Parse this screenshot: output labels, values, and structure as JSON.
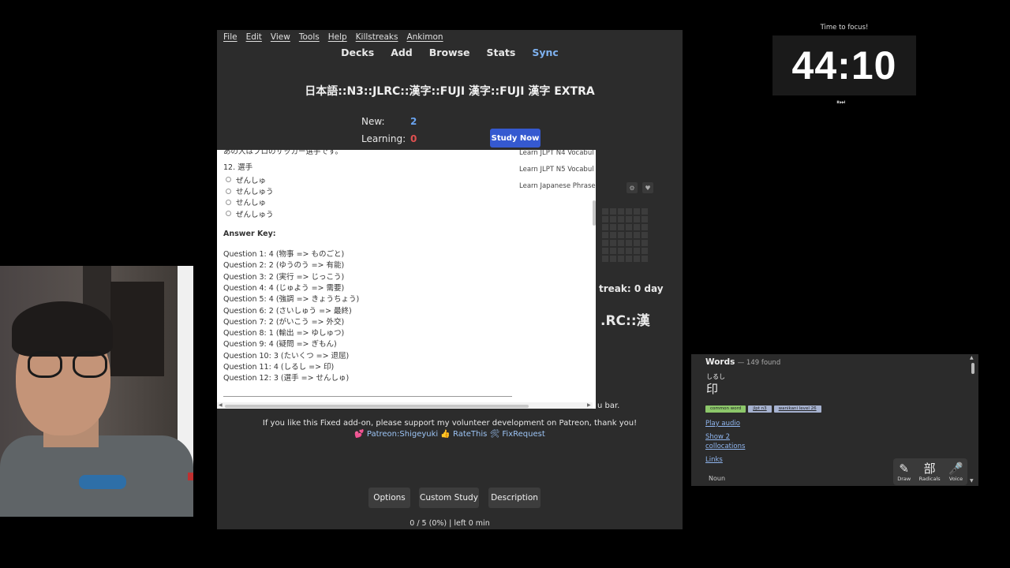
{
  "menu": [
    "File",
    "Edit",
    "View",
    "Tools",
    "Help",
    "Killstreaks",
    "Ankimon"
  ],
  "toolbar": {
    "decks": "Decks",
    "add": "Add",
    "browse": "Browse",
    "stats": "Stats",
    "sync": "Sync"
  },
  "deck": {
    "title": "日本語::N3::JLRC::漢字::FUJI 漢字::FUJI 漢字 EXTRA",
    "new_label": "New:",
    "new_value": "2",
    "learning_label": "Learning:",
    "learning_value": "0",
    "study_now": "Study Now"
  },
  "background": {
    "streak": "treak: 0 day",
    "deck_partial": ".RC::漢",
    "menu_bar_text": "u bar."
  },
  "web": {
    "top_line": "あの人はプロのサッカー選手です。",
    "question": "12. 選手",
    "options": [
      "ぜんしゅ",
      "せんしゅう",
      "せんしゅ",
      "ぜんしゅう"
    ],
    "answer_key_label": "Answer Key:",
    "answers": [
      "Question 1: 4 (物事 => ものごと)",
      "Question 2: 2 (ゆうのう => 有能)",
      "Question 3: 2 (実行 => じっこう)",
      "Question 4: 4 (じゅよう => 需要)",
      "Question 5: 4 (強調 => きょうちょう)",
      "Question 6: 2 (さいしゅう => 最終)",
      "Question 7: 2 (がいこう => 外交)",
      "Question 8: 1 (輸出 => ゆしゅつ)",
      "Question 9: 4 (疑問 => ぎもん)",
      "Question 10: 3 (たいくつ => 退屈)",
      "Question 11: 4 (しるし => 印)",
      "Question 12: 3 (選手 => せんしゅ)"
    ],
    "side_links": [
      "Learn JLPT N4 Vocabul",
      "Learn JLPT N5 Vocabul",
      "Learn Japanese Phrase"
    ]
  },
  "support": {
    "text": "If you like this Fixed add-on, please support my volunteer development on Patreon, thank you!",
    "links": "💕 Patreon:Shigeyuki 👍 RateThis 🛠 FixRequest"
  },
  "buttons": {
    "options": "Options",
    "custom_study": "Custom Study",
    "description": "Description"
  },
  "progress": "0 / 5 (0%) | left 0 min",
  "timer": {
    "label": "Time to focus!",
    "time": "44:10",
    "controls": "⏸⏭"
  },
  "words": {
    "title": "Words",
    "count": "— 149 found",
    "furigana": "しるし",
    "kanji": "印",
    "tags": [
      "common word",
      "jlpt n3",
      "wanikani level 26"
    ],
    "play_audio": "Play audio",
    "show_collocations_1": "Show 2",
    "show_collocations_2": "collocations",
    "links": "Links",
    "noun": "Noun",
    "tools": [
      {
        "icon": "✎",
        "label": "Draw"
      },
      {
        "icon": "部",
        "label": "Radicals"
      },
      {
        "icon": "🎤",
        "label": "Voice"
      }
    ]
  }
}
